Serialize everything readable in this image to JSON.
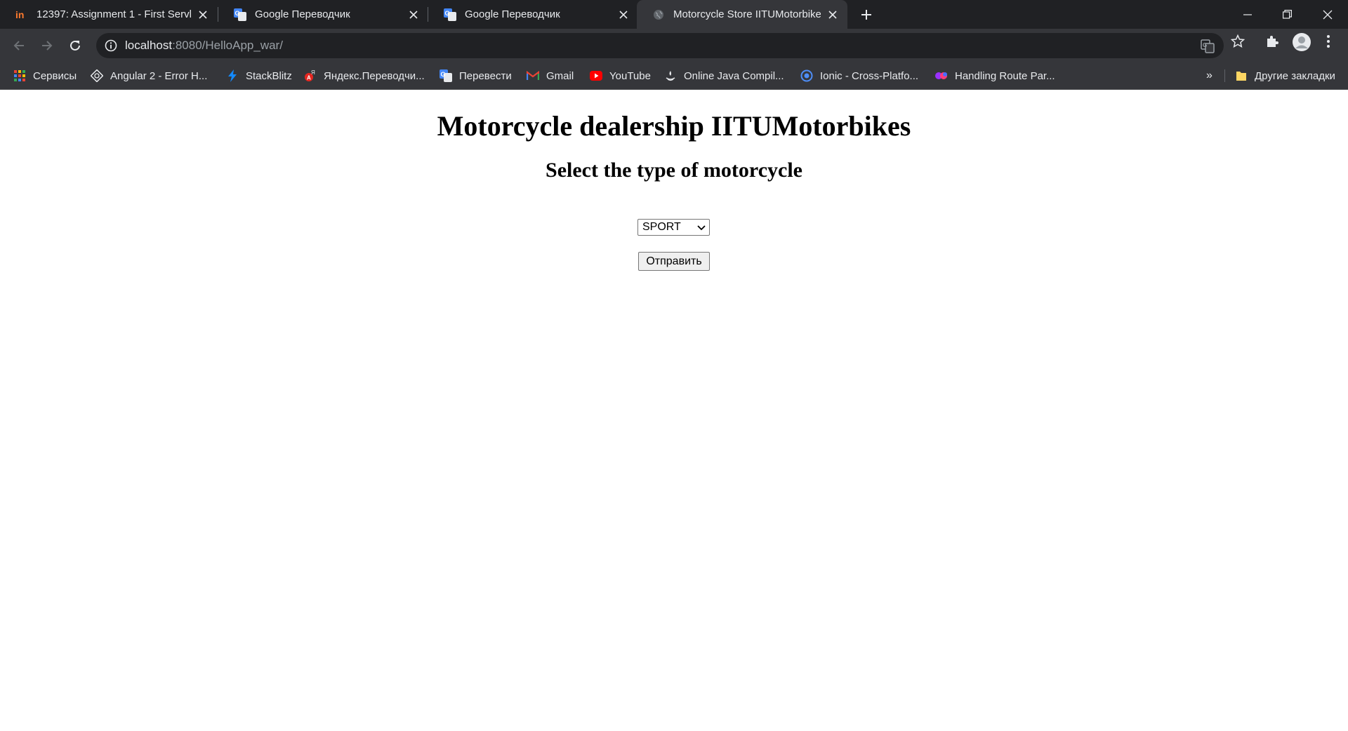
{
  "tabs": [
    {
      "title": "12397: Assignment 1 - First Servl",
      "favicon": "invision-logo-icon",
      "active": false
    },
    {
      "title": "Google Переводчик",
      "favicon": "google-translate-icon",
      "active": false
    },
    {
      "title": "Google Переводчик",
      "favicon": "google-translate-icon",
      "active": false
    },
    {
      "title": "Motorcycle Store IITUMotorbikes",
      "favicon": "globe-icon",
      "active": true
    }
  ],
  "address_bar": {
    "host": "localhost",
    "path": ":8080/HelloApp_war/"
  },
  "bookmarks": [
    {
      "label": "Сервисы",
      "icon": "apps-grid-icon"
    },
    {
      "label": "Angular 2 - Error H...",
      "icon": "angular-icon"
    },
    {
      "label": "StackBlitz",
      "icon": "lightning-icon"
    },
    {
      "label": "Яндекс.Переводчи...",
      "icon": "yandex-translate-icon"
    },
    {
      "label": "Перевести",
      "icon": "google-translate-icon"
    },
    {
      "label": "Gmail",
      "icon": "gmail-icon"
    },
    {
      "label": "YouTube",
      "icon": "youtube-icon"
    },
    {
      "label": "Online Java Compil...",
      "icon": "java-icon"
    },
    {
      "label": "Ionic - Cross-Platfo...",
      "icon": "ionic-icon"
    },
    {
      "label": "Handling Route Par...",
      "icon": "route-icon"
    }
  ],
  "bookmarks_overflow": "»",
  "other_bookmarks": "Другие закладки",
  "page": {
    "heading": "Motorcycle dealership IITUMotorbikes",
    "subheading": "Select the type of motorcycle",
    "select_value": "SPORT",
    "submit_label": "Отправить"
  },
  "colors": {
    "tabstrip_bg": "#202124",
    "toolbar_bg": "#35363a",
    "omnibox_bg": "#202124",
    "text_light": "#e8eaed",
    "page_bg": "#ffffff"
  }
}
